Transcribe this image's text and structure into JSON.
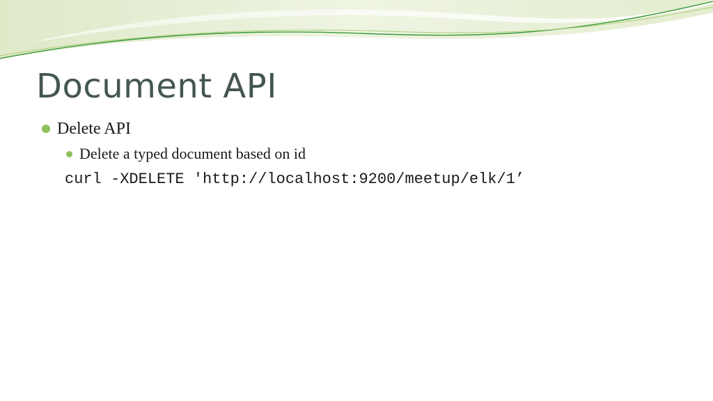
{
  "slide": {
    "title": "Document API",
    "bullets": [
      {
        "text": "Delete API",
        "children": [
          {
            "text": "Delete a typed document based on id"
          }
        ]
      }
    ],
    "code": "curl -XDELETE 'http://localhost:9200/meetup/elk/1’"
  },
  "theme": {
    "title_color": "#44574d",
    "bullet_color": "#8dc15a",
    "accent_green": "#3a9a3a",
    "swoosh_light": "#e6efd4"
  }
}
